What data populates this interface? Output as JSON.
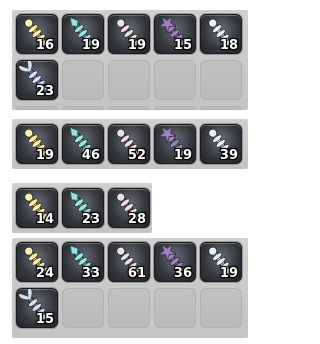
{
  "colors": {
    "gold": "#e2b63a",
    "cyan": "#8fe8e6",
    "red": "#b52f3a",
    "purple": "#a07fc2",
    "silver": "#b7c4d2",
    "blue": "#5474c8"
  },
  "panels": [
    {
      "items": [
        {
          "icon": "gold-ornament-icon",
          "qty": "16"
        },
        {
          "icon": "cyan-crystal-ornament-icon",
          "qty": "19"
        },
        {
          "icon": "red-ornament-icon",
          "qty": "19"
        },
        {
          "icon": "purple-star-ornament-icon",
          "qty": "15"
        },
        {
          "icon": "silver-ornament-icon",
          "qty": "18"
        },
        {
          "icon": "blue-feather-ornament-icon",
          "qty": "23"
        }
      ]
    },
    {
      "items": [
        {
          "icon": "gold-ornament-icon",
          "qty": "19"
        },
        {
          "icon": "cyan-crystal-ornament-icon",
          "qty": "46"
        },
        {
          "icon": "red-ornament-icon",
          "qty": "52"
        },
        {
          "icon": "purple-star-ornament-icon",
          "qty": "19"
        },
        {
          "icon": "silver-ornament-icon",
          "qty": "39"
        }
      ]
    },
    {
      "items": [
        {
          "icon": "gold-ornament-icon",
          "qty": "14"
        },
        {
          "icon": "cyan-crystal-ornament-icon",
          "qty": "23"
        },
        {
          "icon": "red-ornament-icon",
          "qty": "28"
        }
      ]
    },
    {
      "items": [
        {
          "icon": "gold-ornament-icon",
          "qty": "24"
        },
        {
          "icon": "cyan-crystal-ornament-icon",
          "qty": "33"
        },
        {
          "icon": "red-ornament-icon",
          "qty": "61"
        },
        {
          "icon": "purple-star-ornament-icon",
          "qty": "36"
        },
        {
          "icon": "silver-ornament-icon",
          "qty": "19"
        },
        {
          "icon": "blue-feather-ornament-icon",
          "qty": "15"
        }
      ]
    }
  ]
}
